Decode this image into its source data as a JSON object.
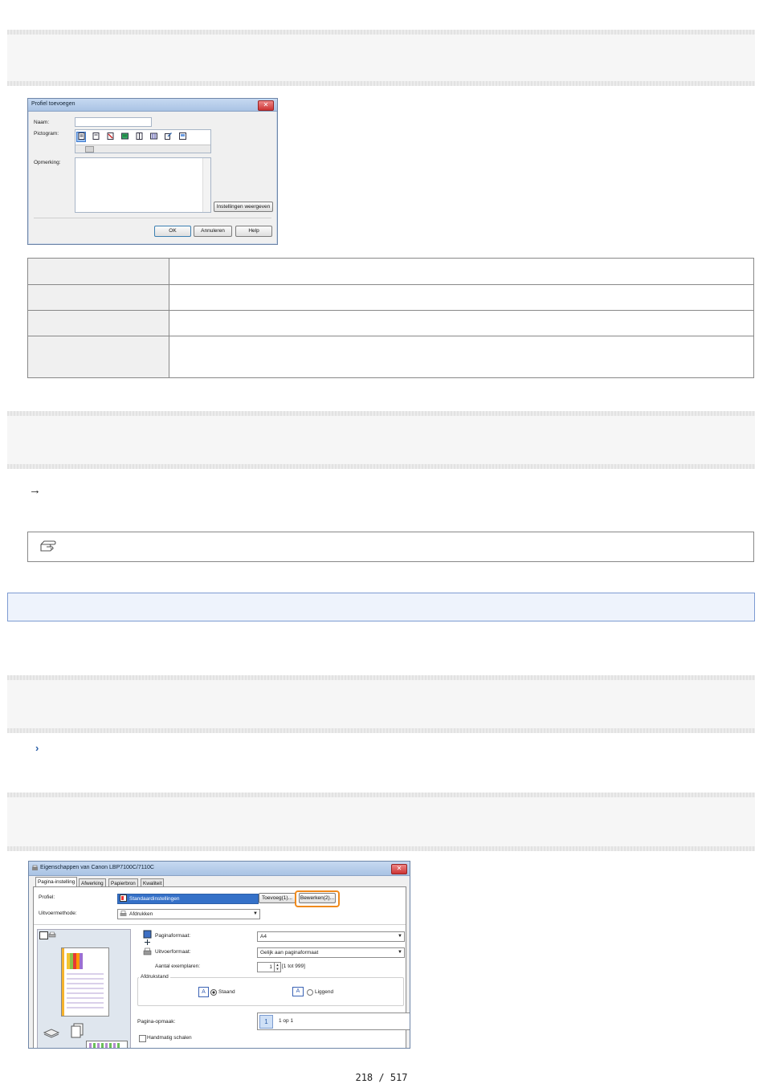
{
  "dialog_add_profile": {
    "title": "Profiel toevoegen",
    "name_label": "Naam:",
    "icon_label": "Pictogram:",
    "comment_label": "Opmerking:",
    "show_settings_button": "Instellingen weergeven",
    "ok_button": "OK",
    "cancel_button": "Annuleren",
    "help_button": "Help",
    "close_glyph": "✕"
  },
  "arrow_text": "→",
  "bullet_text": "›",
  "dialog_properties": {
    "title": "Eigenschappen van Canon LBP7100C/7110C",
    "tabs": [
      "Pagina-instelling",
      "Afwerking",
      "Papierbron",
      "Kwaliteit"
    ],
    "profile_label": "Profiel:",
    "profile_value": "Standaardinstellingen",
    "add_button": "Toevoeg(1)...",
    "edit_button": "Bewerken(2)...",
    "output_method_label": "Uitvoermethode:",
    "output_method_value": "Afdrukken",
    "page_size_label": "Paginaformaat:",
    "page_size_value": "A4",
    "output_size_label": "Uitvoerformaat:",
    "output_size_value": "Gelijk aan paginaformaat",
    "copies_label": "Aantal exemplaren:",
    "copies_value": "1",
    "copies_range": "[1 tot 999]",
    "orientation_label": "Afdrukstand",
    "portrait_label": "Staand",
    "landscape_label": "Liggend",
    "page_layout_label": "Pagina-opmaak:",
    "page_layout_value": "1 op 1",
    "manual_scaling_label": "Handmatig schalen",
    "close_glyph": "✕",
    "highlight_color": "#f08a1c"
  },
  "footer": {
    "page_indicator": "218 / 517"
  }
}
